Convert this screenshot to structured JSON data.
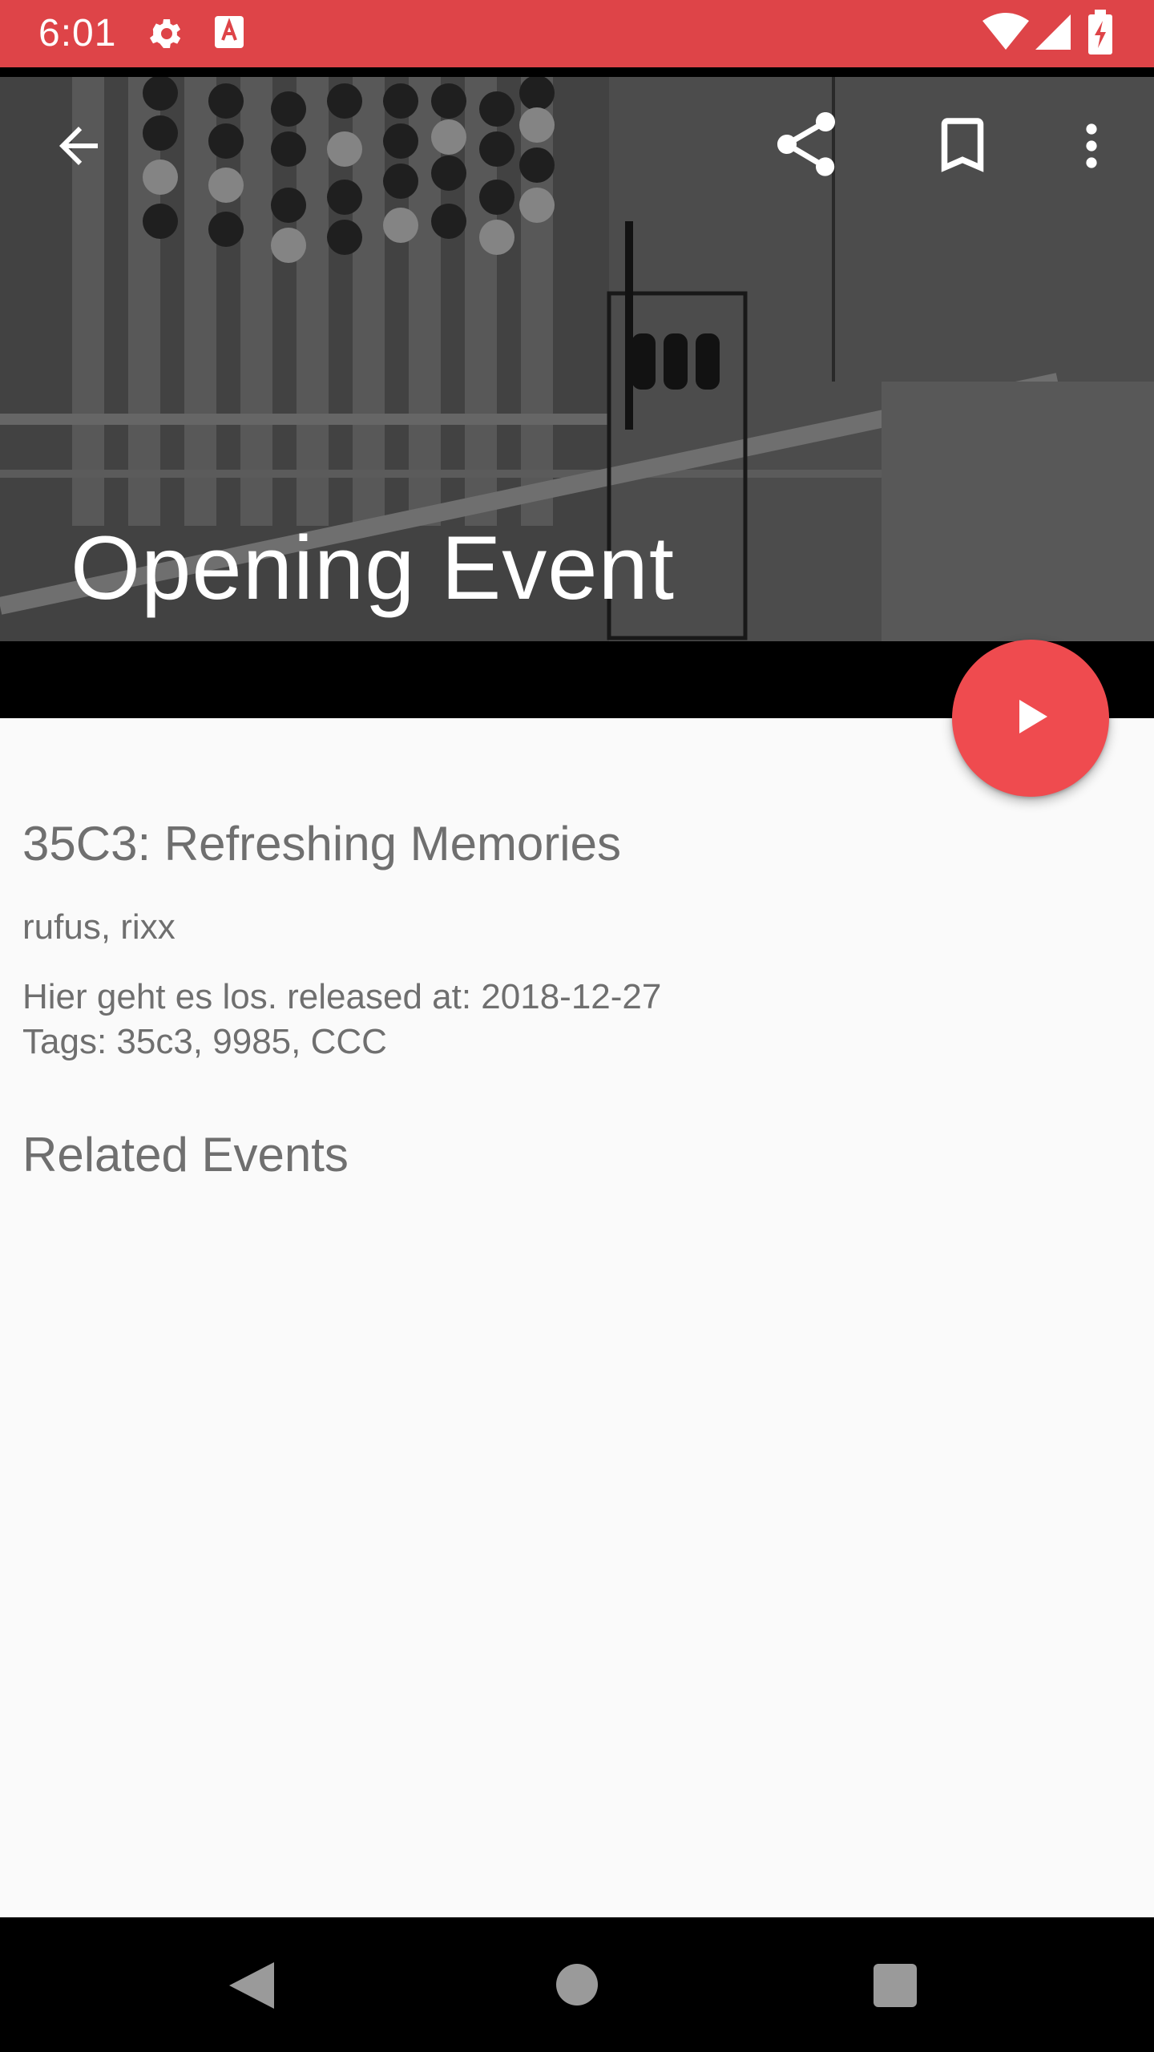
{
  "status_bar": {
    "time": "6:01",
    "icons": [
      "settings-icon",
      "text-a-icon",
      "wifi-icon",
      "signal-icon",
      "battery-charging-icon"
    ]
  },
  "toolbar": {
    "icons": [
      "back-arrow-icon",
      "share-icon",
      "bookmark-icon",
      "more-vert-icon"
    ]
  },
  "hero": {
    "title": "Opening Event"
  },
  "event": {
    "conference": "35C3: Refreshing Memories",
    "persons": "rufus, rixx",
    "description_line1": "Hier geht es los. released at: 2018-12-27",
    "description_line2": "Tags: 35c3, 9985, CCC"
  },
  "related": {
    "title": "Related Events"
  },
  "fab": {
    "icon": "play-icon",
    "color": "#ef4b4f"
  },
  "nav_bar": {
    "icons": [
      "nav-back-icon",
      "nav-home-icon",
      "nav-recents-icon"
    ]
  },
  "colors": {
    "status_bar": "#de4448",
    "accent": "#ef4b4f",
    "content_bg": "#fafafa",
    "text_secondary": "#6f6f6f"
  }
}
